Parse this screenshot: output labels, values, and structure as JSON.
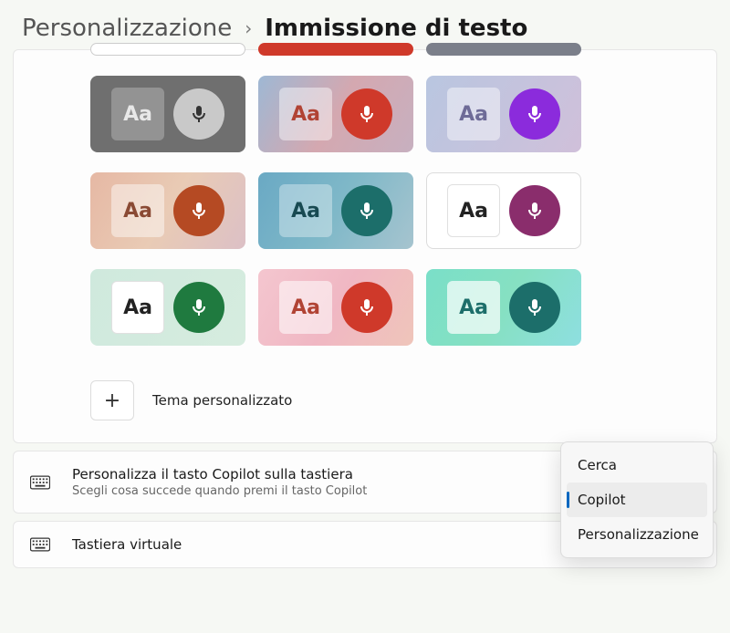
{
  "breadcrumb": {
    "parent": "Personalizzazione",
    "separator": "›",
    "current": "Immissione di testo"
  },
  "themes": {
    "aa_label": "Aa",
    "custom_label": "Tema personalizzato",
    "items": [
      {
        "name": "dark",
        "aa_color": "#e8e8e8",
        "mic_bg": "#c9c9c9",
        "mic_fg": "#333333"
      },
      {
        "name": "sunset",
        "aa_color": "#b14334",
        "mic_bg": "#cf392a",
        "mic_fg": "#ffffff"
      },
      {
        "name": "lavender",
        "aa_color": "#6e6b97",
        "mic_bg": "#8b2bdc",
        "mic_fg": "#ffffff"
      },
      {
        "name": "earth",
        "aa_color": "#8a4a34",
        "mic_bg": "#b54a23",
        "mic_fg": "#ffffff"
      },
      {
        "name": "ocean",
        "aa_color": "#184a52",
        "mic_bg": "#1c6e6a",
        "mic_fg": "#ffffff"
      },
      {
        "name": "white-magenta",
        "aa_color": "#222222",
        "mic_bg": "#8a2d6c",
        "mic_fg": "#ffffff"
      },
      {
        "name": "mint-green",
        "aa_color": "#222222",
        "mic_bg": "#1f7a3f",
        "mic_fg": "#ffffff"
      },
      {
        "name": "pink-red",
        "aa_color": "#b14334",
        "mic_bg": "#cf392a",
        "mic_fg": "#ffffff"
      },
      {
        "name": "teal",
        "aa_color": "#1c6e6a",
        "mic_bg": "#1c6e6a",
        "mic_fg": "#ffffff"
      }
    ]
  },
  "settings": {
    "copilot": {
      "title": "Personalizza il tasto Copilot sulla tastiera",
      "sub": "Scegli cosa succede quando premi il tasto Copilot"
    },
    "virtual_keyboard": {
      "title": "Tastiera virtuale"
    }
  },
  "popup": {
    "items": [
      {
        "label": "Cerca",
        "selected": false
      },
      {
        "label": "Copilot",
        "selected": true
      },
      {
        "label": "Personalizzazione",
        "selected": false
      }
    ]
  }
}
